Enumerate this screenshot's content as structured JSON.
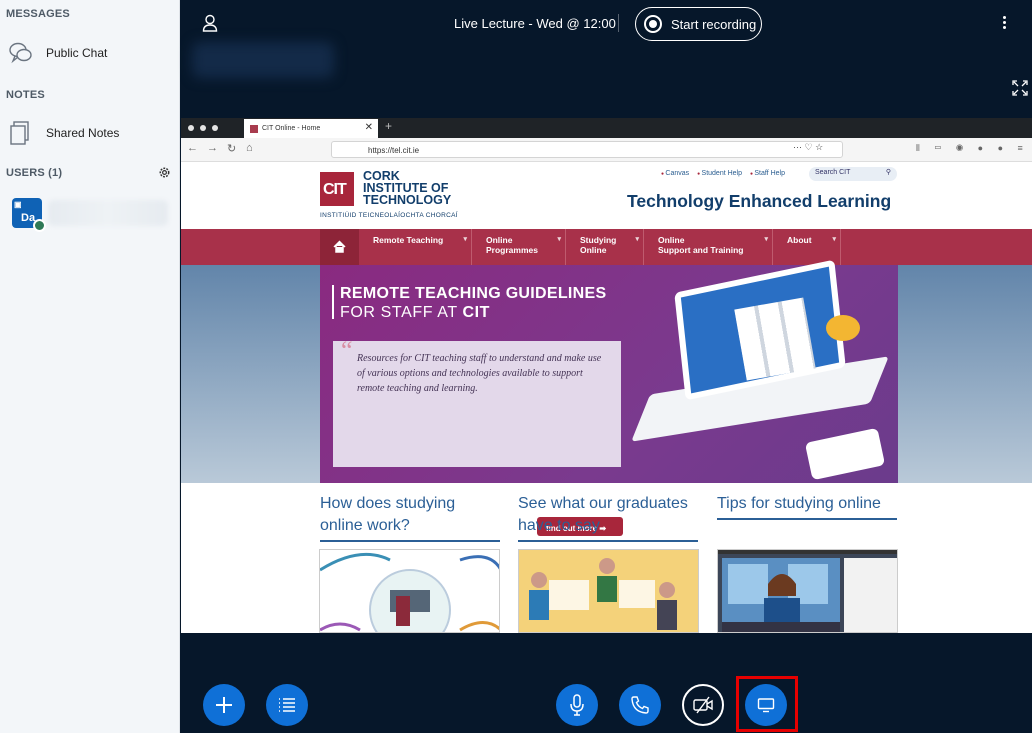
{
  "sidebar": {
    "messages_heading": "MESSAGES",
    "public_chat": "Public Chat",
    "notes_heading": "NOTES",
    "shared_notes": "Shared Notes",
    "users_heading": "USERS (1)",
    "user_initials": "Da"
  },
  "topbar": {
    "title": "Live Lecture - Wed @ 12:00",
    "record_label": "Start recording"
  },
  "browser": {
    "tab_title": "CIT Online - Home",
    "url": "https://tel.cit.ie",
    "url_dots": "···"
  },
  "site": {
    "logo_text": "CIT",
    "name_line1": "CORK",
    "name_line2": "INSTITUTE OF",
    "name_line3": "TECHNOLOGY",
    "irish_name": "INSTITIÚID TEICNEOLAÍOCHTA CHORCAÍ",
    "links": [
      "Canvas",
      "Student Help",
      "Staff Help"
    ],
    "search_placeholder": "Search CIT",
    "title": "Technology Enhanced Learning",
    "nav": [
      "Remote Teaching",
      "Online\nProgrammes",
      "Studying\nOnline",
      "Online\nSupport and Training",
      "About"
    ],
    "hero_line1": "REMOTE TEACHING GUIDELINES",
    "hero_line2a": "FOR STAFF AT ",
    "hero_line2b": "CIT",
    "hero_quote": "Resources for CIT teaching staff to understand and make use of various options and technologies available to support remote teaching and learning.",
    "find_out_more": "find out more ➡",
    "columns": [
      "How does studying online work?",
      "See what our graduates have to say",
      "Tips for studying online"
    ]
  },
  "colors": {
    "sidebar_bg": "#f3f6f9",
    "app_bg": "#06172a",
    "control_blue": "#0f70d7",
    "cit_red": "#a8263b",
    "cit_navy": "#123e6b",
    "highlight": "#e60000"
  }
}
